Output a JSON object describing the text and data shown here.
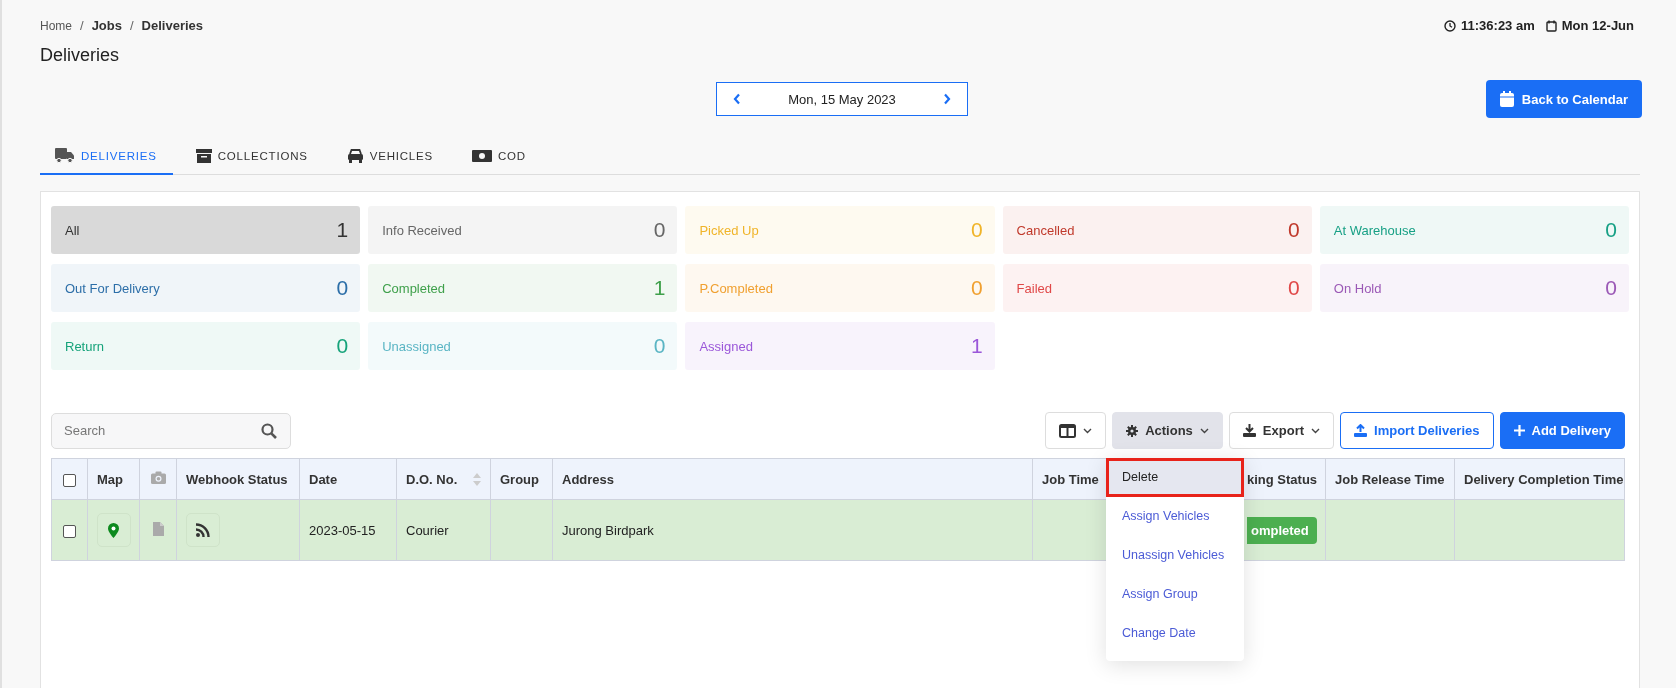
{
  "breadcrumb": [
    {
      "kind": "link",
      "label": "Home",
      "current": false
    },
    {
      "kind": "separator",
      "label": "/"
    },
    {
      "kind": "link",
      "label": "Jobs",
      "current": true
    },
    {
      "kind": "separator",
      "label": "/"
    },
    {
      "kind": "link",
      "label": "Deliveries",
      "current": true
    }
  ],
  "page_title": "Deliveries",
  "clock": {
    "time": "11:36:23 am",
    "date": "Mon 12-Jun"
  },
  "date_nav": {
    "label": "Mon, 15 May 2023"
  },
  "back_button": "Back to Calendar",
  "tabs": [
    {
      "label": "DELIVERIES",
      "selected": true
    },
    {
      "label": "COLLECTIONS",
      "selected": false
    },
    {
      "label": "VEHICLES",
      "selected": false
    },
    {
      "label": "COD",
      "selected": false
    }
  ],
  "status_tiles": [
    {
      "label": "All",
      "count": "1",
      "color": "#333333",
      "selected": true
    },
    {
      "label": "Info Received",
      "count": "0",
      "color": "#666666",
      "selected": false
    },
    {
      "label": "Picked Up",
      "count": "0",
      "color": "#f0b429",
      "selected": false
    },
    {
      "label": "Cancelled",
      "count": "0",
      "color": "#c0392b",
      "selected": false
    },
    {
      "label": "At Warehouse",
      "count": "0",
      "color": "#17a085",
      "selected": false
    },
    {
      "label": "Out For Delivery",
      "count": "0",
      "color": "#2c6ea8",
      "selected": false
    },
    {
      "label": "Completed",
      "count": "1",
      "color": "#3fa04b",
      "selected": false
    },
    {
      "label": "P.Completed",
      "count": "0",
      "color": "#f0a030",
      "selected": false
    },
    {
      "label": "Failed",
      "count": "0",
      "color": "#e04848",
      "selected": false
    },
    {
      "label": "On Hold",
      "count": "0",
      "color": "#9b59b6",
      "selected": false
    },
    {
      "label": "Return",
      "count": "0",
      "color": "#16a37a",
      "selected": false
    },
    {
      "label": "Unassigned",
      "count": "0",
      "color": "#5ab5c4",
      "selected": false
    },
    {
      "label": "Assigned",
      "count": "1",
      "color": "#9b57d9",
      "selected": false
    }
  ],
  "search": {
    "placeholder": "Search"
  },
  "toolbar": {
    "actions": "Actions",
    "export": "Export",
    "import": "Import Deliveries",
    "add": "Add Delivery"
  },
  "table": {
    "columns": [
      {
        "kind": "checkbox",
        "checked": false
      },
      {
        "kind": "text",
        "label": "Map"
      },
      {
        "kind": "camera"
      },
      {
        "kind": "text",
        "label": "Webhook Status"
      },
      {
        "kind": "text",
        "label": "Date"
      },
      {
        "kind": "sortable",
        "label": "D.O. No."
      },
      {
        "kind": "text",
        "label": "Group"
      },
      {
        "kind": "text",
        "label": "Address"
      },
      {
        "kind": "text",
        "label": "Job Time"
      },
      {
        "kind": "covered",
        "label": "king Status"
      },
      {
        "kind": "text",
        "label": "Job Release Time"
      },
      {
        "kind": "text",
        "label": "Delivery Completion Time"
      }
    ],
    "rows": [
      {
        "checked": false,
        "date": "2023-05-15",
        "do_no": "Courier",
        "address": "Jurong Birdpark",
        "tracking_status": "ompleted"
      }
    ]
  },
  "actions_menu": [
    {
      "label": "Delete",
      "selected": true
    },
    {
      "label": "Assign Vehicles",
      "selected": false
    },
    {
      "label": "Unassign Vehicles",
      "selected": false
    },
    {
      "label": "Assign Group",
      "selected": false
    },
    {
      "label": "Change Date",
      "selected": false
    }
  ]
}
